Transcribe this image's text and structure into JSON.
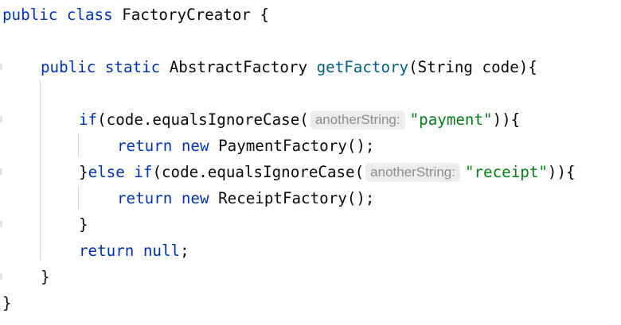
{
  "code": {
    "l1": {
      "kw1": "public",
      "kw2": "class",
      "name": "FactoryCreator",
      "brace": "{"
    },
    "l2": {
      "kw1": "public",
      "kw2": "static",
      "type": "AbstractFactory",
      "method": "getFactory",
      "params": "(String code){"
    },
    "l3": {
      "kw": "if",
      "expr": "(code.equalsIgnoreCase(",
      "hint": "anotherString:",
      "str": "\"payment\"",
      "tail": ")){"
    },
    "l4": {
      "kw1": "return",
      "kw2": "new",
      "rest": "PaymentFactory();"
    },
    "l5": {
      "close": "}",
      "kw1": "else",
      "kw2": "if",
      "expr": "(code.equalsIgnoreCase(",
      "hint": "anotherString:",
      "str": "\"receipt\"",
      "tail": ")){"
    },
    "l6": {
      "kw1": "return",
      "kw2": "new",
      "rest": "ReceiptFactory();"
    },
    "l7": {
      "brace": "}"
    },
    "l8": {
      "kw1": "return",
      "kw2": "null",
      "semi": ";"
    },
    "l9": {
      "brace": "}"
    },
    "l10": {
      "brace": "}"
    }
  }
}
